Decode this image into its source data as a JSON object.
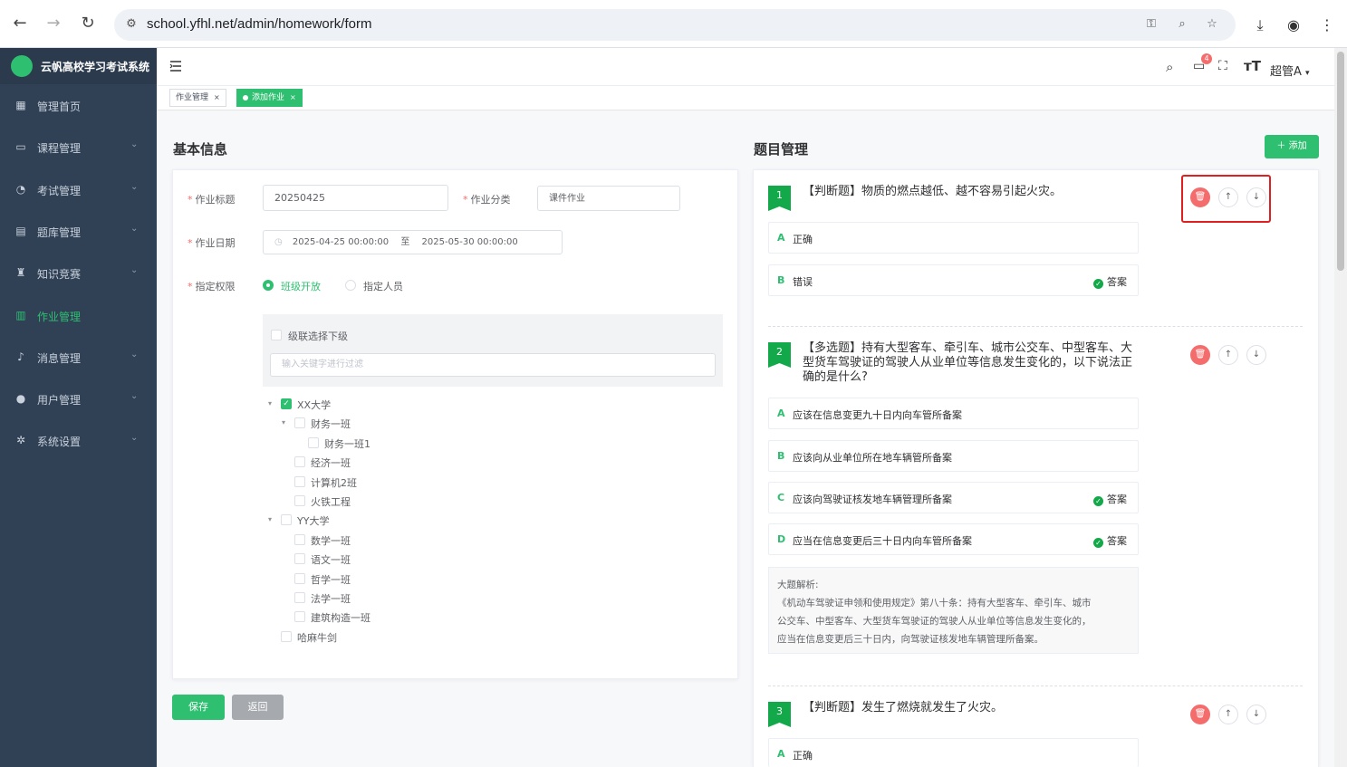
{
  "browser": {
    "url": "school.yfhl.net/admin/homework/form"
  },
  "app": {
    "title": "云帆高校学习考试系统"
  },
  "sidebar": {
    "items": [
      {
        "label": "管理首页",
        "icon": "dashboard-icon",
        "expandable": false
      },
      {
        "label": "课程管理",
        "icon": "monitor-icon",
        "expandable": true
      },
      {
        "label": "考试管理",
        "icon": "gauge-icon",
        "expandable": true
      },
      {
        "label": "题库管理",
        "icon": "document-icon",
        "expandable": true
      },
      {
        "label": "知识竞赛",
        "icon": "trophy-icon",
        "expandable": true
      },
      {
        "label": "作业管理",
        "icon": "table-icon",
        "expandable": false,
        "active": true
      },
      {
        "label": "消息管理",
        "icon": "bell-icon",
        "expandable": true
      },
      {
        "label": "用户管理",
        "icon": "user-icon",
        "expandable": true
      },
      {
        "label": "系统设置",
        "icon": "gear-icon",
        "expandable": true
      }
    ]
  },
  "header": {
    "notifications": "4",
    "user": "超管A"
  },
  "tabs": [
    {
      "label": "作业管理",
      "active": false
    },
    {
      "label": "添加作业",
      "active": true
    }
  ],
  "basic": {
    "title": "基本信息",
    "fields": {
      "title_label": "作业标题",
      "title_value": "20250425",
      "category_label": "作业分类",
      "category_value": "课件作业",
      "date_label": "作业日期",
      "date_start": "2025-04-25 00:00:00",
      "date_sep": "至",
      "date_end": "2025-05-30 00:00:00",
      "perm_label": "指定权限",
      "perm_option1": "班级开放",
      "perm_option2": "指定人员"
    },
    "cascade_label": "级联选择下级",
    "filter_placeholder": "输入关键字进行过滤",
    "tree": [
      "XX大学",
      "财务一班",
      "财务一班1",
      "经济一班",
      "计算机2班",
      "火铁工程",
      "YY大学",
      "数学一班",
      "语文一班",
      "哲学一班",
      "法学一班",
      "建筑构造一班",
      "哈麻牛剑"
    ],
    "save": "保存",
    "back": "返回"
  },
  "questions": {
    "title": "题目管理",
    "add": "添加",
    "answer_label": "答案",
    "q1": {
      "num": "1",
      "text": "【判断题】物质的燃点越低、越不容易引起火灾。",
      "options": [
        {
          "key": "A",
          "text": "正确"
        },
        {
          "key": "B",
          "text": "错误"
        }
      ]
    },
    "q2": {
      "num": "2",
      "line1": "【多选题】持有大型客车、牵引车、城市公交车、中型客车、大",
      "line2": "型货车驾驶证的驾驶人从业单位等信息发生变化的，以下说法正",
      "line3": "确的是什么?",
      "options": [
        {
          "key": "A",
          "text": "应该在信息变更九十日内向车管所备案"
        },
        {
          "key": "B",
          "text": "应该向从业单位所在地车辆管所备案"
        },
        {
          "key": "C",
          "text": "应该向驾驶证核发地车辆管理所备案"
        },
        {
          "key": "D",
          "text": "应当在信息变更后三十日内向车管所备案"
        }
      ],
      "analysis_title": "大题解析:",
      "analysis_l1": "《机动车驾驶证申领和使用规定》第八十条：持有大型客车、牵引车、城市",
      "analysis_l2": "公交车、中型客车、大型货车驾驶证的驾驶人从业单位等信息发生变化的，",
      "analysis_l3": "应当在信息变更后三十日内，向驾驶证核发地车辆管理所备案。"
    },
    "q3": {
      "num": "3",
      "text": "【判断题】发生了燃烧就发生了火灾。",
      "options": [
        {
          "key": "A",
          "text": "正确"
        }
      ]
    }
  },
  "colors": {
    "accent": "#2fbf71",
    "sidebar": "#304156",
    "danger": "#f56c6c",
    "highlight": "#e02020"
  }
}
